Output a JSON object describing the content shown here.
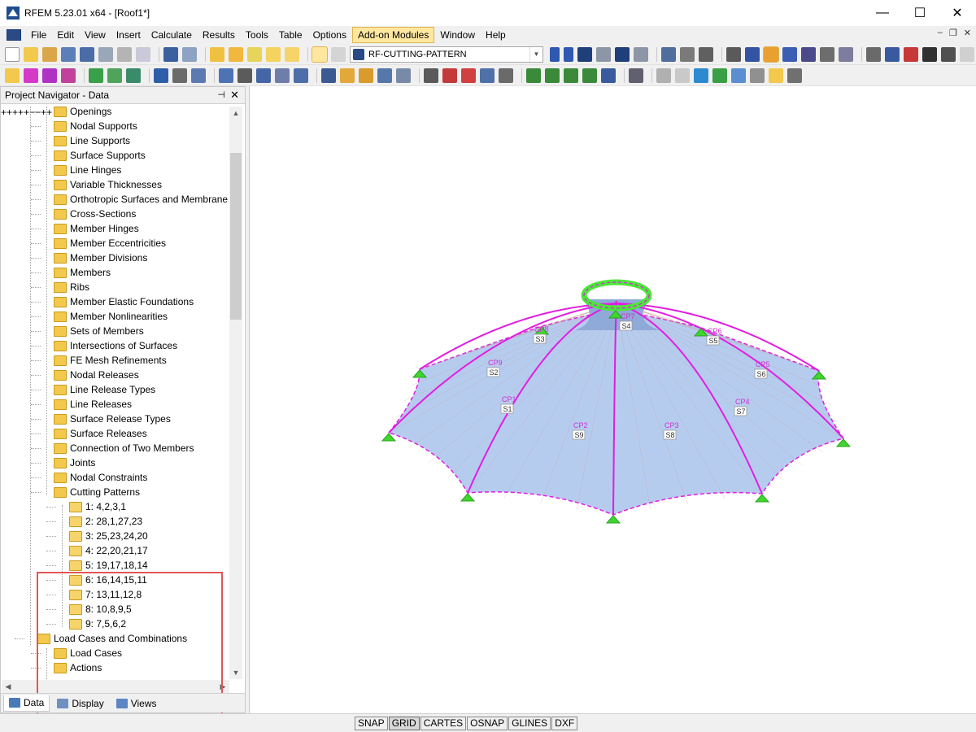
{
  "window": {
    "title": "RFEM 5.23.01 x64 - [Roof1*]",
    "minimize": "—",
    "maximize": "☐",
    "close": "✕"
  },
  "menubar": {
    "items": [
      "File",
      "Edit",
      "View",
      "Insert",
      "Calculate",
      "Results",
      "Tools",
      "Table",
      "Options",
      "Add-on Modules",
      "Window",
      "Help"
    ],
    "active": "Add-on Modules",
    "mdi": {
      "minimize": "–",
      "restore": "❐",
      "close": "✕"
    }
  },
  "toolbar": {
    "module_select": "RF-CUTTING-PATTERN"
  },
  "navigator": {
    "title": "Project Navigator - Data",
    "pin": "⊣",
    "close": "✕",
    "tree": [
      {
        "label": "Openings",
        "level": 3,
        "expandable": false
      },
      {
        "label": "Nodal Supports",
        "level": 3,
        "expandable": true
      },
      {
        "label": "Line Supports",
        "level": 3,
        "expandable": true
      },
      {
        "label": "Surface Supports",
        "level": 3,
        "expandable": false
      },
      {
        "label": "Line Hinges",
        "level": 3,
        "expandable": false
      },
      {
        "label": "Variable Thicknesses",
        "level": 3,
        "expandable": false
      },
      {
        "label": "Orthotropic Surfaces and Membrane",
        "level": 3,
        "expandable": true
      },
      {
        "label": "Cross-Sections",
        "level": 3,
        "expandable": true
      },
      {
        "label": "Member Hinges",
        "level": 3,
        "expandable": false
      },
      {
        "label": "Member Eccentricities",
        "level": 3,
        "expandable": false
      },
      {
        "label": "Member Divisions",
        "level": 3,
        "expandable": false
      },
      {
        "label": "Members",
        "level": 3,
        "expandable": true
      },
      {
        "label": "Ribs",
        "level": 3,
        "expandable": false
      },
      {
        "label": "Member Elastic Foundations",
        "level": 3,
        "expandable": false
      },
      {
        "label": "Member Nonlinearities",
        "level": 3,
        "expandable": false
      },
      {
        "label": "Sets of Members",
        "level": 3,
        "expandable": false
      },
      {
        "label": "Intersections of Surfaces",
        "level": 3,
        "expandable": false
      },
      {
        "label": "FE Mesh Refinements",
        "level": 3,
        "expandable": false
      },
      {
        "label": "Nodal Releases",
        "level": 3,
        "expandable": false
      },
      {
        "label": "Line Release Types",
        "level": 3,
        "expandable": false
      },
      {
        "label": "Line Releases",
        "level": 3,
        "expandable": false
      },
      {
        "label": "Surface Release Types",
        "level": 3,
        "expandable": false
      },
      {
        "label": "Surface Releases",
        "level": 3,
        "expandable": false
      },
      {
        "label": "Connection of Two Members",
        "level": 3,
        "expandable": false
      },
      {
        "label": "Joints",
        "level": 3,
        "expandable": false
      },
      {
        "label": "Nodal Constraints",
        "level": 3,
        "expandable": false
      },
      {
        "label": "Cutting Patterns",
        "level": 3,
        "expandable": true,
        "expanded": true
      },
      {
        "label": "1: 4,2,3,1",
        "level": 4,
        "expandable": false
      },
      {
        "label": "2: 28,1,27,23",
        "level": 4,
        "expandable": false
      },
      {
        "label": "3: 25,23,24,20",
        "level": 4,
        "expandable": false
      },
      {
        "label": "4: 22,20,21,17",
        "level": 4,
        "expandable": false
      },
      {
        "label": "5: 19,17,18,14",
        "level": 4,
        "expandable": false
      },
      {
        "label": "6: 16,14,15,11",
        "level": 4,
        "expandable": false
      },
      {
        "label": "7: 13,11,12,8",
        "level": 4,
        "expandable": false
      },
      {
        "label": "8: 10,8,9,5",
        "level": 4,
        "expandable": false
      },
      {
        "label": "9: 7,5,6,2",
        "level": 4,
        "expandable": false
      },
      {
        "label": "Load Cases and Combinations",
        "level": 2,
        "expandable": true,
        "expanded": true
      },
      {
        "label": "Load Cases",
        "level": 3,
        "expandable": true
      },
      {
        "label": "Actions",
        "level": 3,
        "expandable": true
      }
    ],
    "tabs": [
      "Data",
      "Display",
      "Views"
    ],
    "active_tab": "Data"
  },
  "model": {
    "cutting_labels": [
      {
        "text": "CP7",
        "sub": "S4"
      },
      {
        "text": "CP8",
        "sub": "S3"
      },
      {
        "text": "CP6",
        "sub": "S5"
      },
      {
        "text": "CP9",
        "sub": "S2"
      },
      {
        "text": "CP5",
        "sub": "S6"
      },
      {
        "text": "CP1",
        "sub": "S1"
      },
      {
        "text": "CP4",
        "sub": "S7"
      },
      {
        "text": "CP2",
        "sub": "S9"
      },
      {
        "text": "CP3",
        "sub": "S8"
      }
    ],
    "colors": {
      "membrane": "#a9c3ec",
      "edge": "#e11de0",
      "support": "#3fd62f",
      "ring": "#4be63a"
    }
  },
  "statusbar": {
    "buttons": [
      "SNAP",
      "GRID",
      "CARTES",
      "OSNAP",
      "GLINES",
      "DXF"
    ],
    "active": "GRID"
  }
}
